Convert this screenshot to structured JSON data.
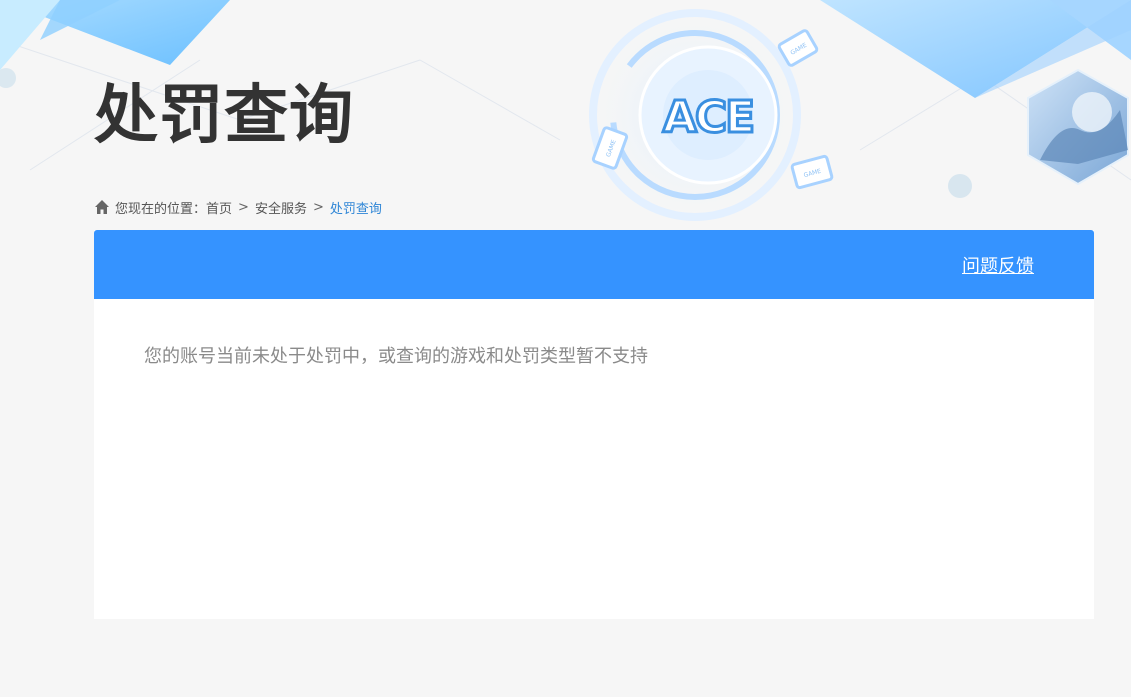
{
  "header": {
    "title": "处罚查询",
    "logo_text": "ACE",
    "game_badge": "GAME"
  },
  "breadcrumb": {
    "prefix": "您现在的位置：",
    "items": [
      "首页",
      "安全服务",
      "处罚查询"
    ],
    "separator": ">"
  },
  "panel": {
    "feedback_label": "问题反馈",
    "message": "您的账号当前未处于处罚中，或查询的游戏和处罚类型暂不支持"
  },
  "colors": {
    "accent": "#3593ff",
    "breadcrumb_current": "#2f86d6",
    "title": "#333333",
    "message": "#8a8a8a"
  },
  "icons": [
    "home-icon"
  ]
}
